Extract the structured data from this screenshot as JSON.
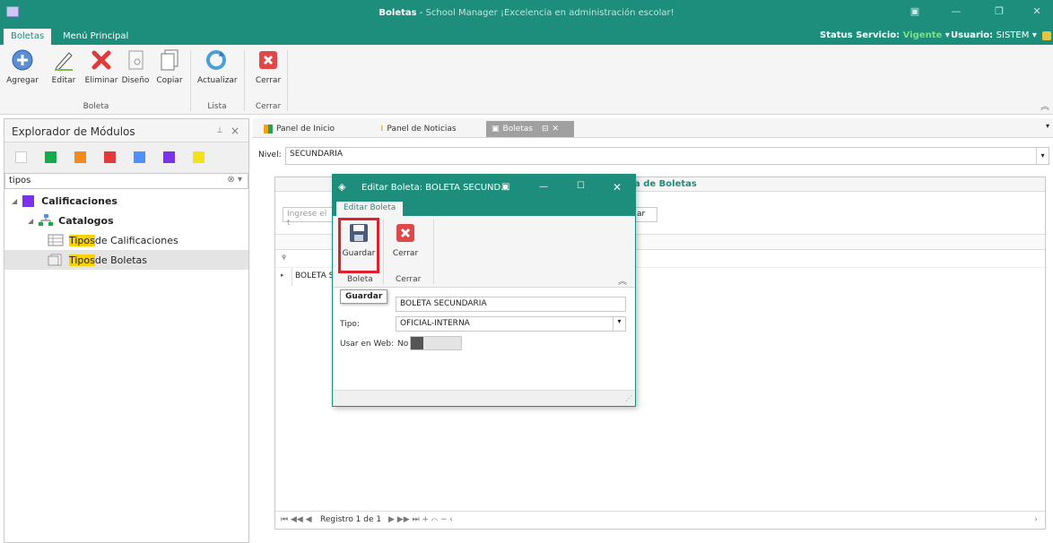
{
  "titlebar": {
    "app_name": "Boletas",
    "separator": " - ",
    "subtitle": "School Manager ¡Excelencia en administración escolar!"
  },
  "ribbon_tabs": [
    {
      "label": "Boletas"
    },
    {
      "label": "Menú Principal"
    }
  ],
  "status": {
    "servicio_label": "Status Servicio:",
    "servicio_value": "Vigente",
    "usuario_label": "Usuario:",
    "usuario_value": "SISTEM"
  },
  "ribbon": {
    "buttons": [
      {
        "label": "Agregar",
        "icon": "add-icon"
      },
      {
        "label": "Editar",
        "icon": "edit-icon"
      },
      {
        "label": "Eliminar",
        "icon": "delete-icon"
      },
      {
        "label": "Diseño",
        "icon": "design-icon"
      },
      {
        "label": "Copiar",
        "icon": "copy-icon"
      },
      {
        "label": "Actualizar",
        "icon": "refresh-icon"
      },
      {
        "label": "Cerrar",
        "icon": "close-icon"
      }
    ],
    "groups": [
      "Boleta",
      "Lista",
      "Cerrar"
    ]
  },
  "left_panel": {
    "title": "Explorador de Módulos",
    "pin": "⊥",
    "close": "×",
    "colors": [
      "#ffffff",
      "#19a84c",
      "#f28a1c",
      "#e23a3a",
      "#4e90ff",
      "#7a33e6",
      "#f3e119"
    ],
    "search_value": "tipos",
    "tree": {
      "root": "Calificaciones",
      "child": "Catalogos",
      "items": [
        {
          "hl": "Tipos",
          "rest": " de Calificaciones"
        },
        {
          "hl": "Tipos",
          "rest": " de Boletas"
        }
      ]
    }
  },
  "doc_tabs": [
    {
      "label": "Panel de Inicio"
    },
    {
      "label": "Panel de Noticias"
    },
    {
      "label": "Boletas"
    }
  ],
  "nivel": {
    "label": "Nivel:",
    "value": "SECUNDARIA"
  },
  "grid": {
    "header_title": "a de Boletas",
    "search_placeholder": "Ingrese el t",
    "search_btn": "ar",
    "row_text": "BOLETA SE",
    "footer": "Registro 1 de 1"
  },
  "dialog": {
    "title": "Editar Boleta: BOLETA SECUND...",
    "tab": "Editar Boleta",
    "guardar": "Guardar",
    "cerrar": "Cerrar",
    "group_boleta": "Boleta",
    "group_cerrar": "Cerrar",
    "tooltip": "Guardar",
    "nombre_value": "BOLETA SECUNDARIA",
    "tipo_label": "Tipo:",
    "tipo_value": "OFICIAL-INTERNA",
    "web_label": "Usar en Web:",
    "web_value": "No"
  }
}
